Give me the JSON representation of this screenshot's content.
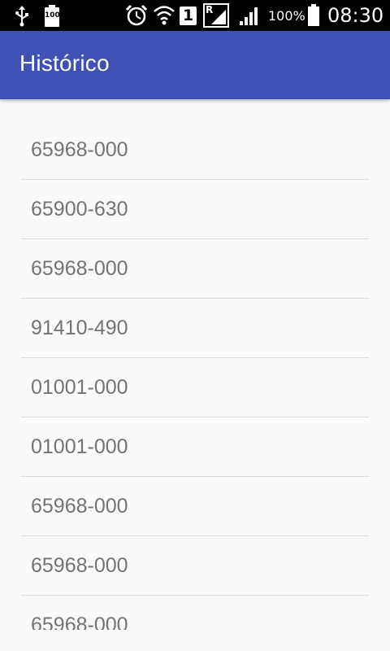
{
  "status_bar": {
    "battery_badge": "100",
    "sim_slot": "1",
    "roaming": "R",
    "battery_percent": "100%",
    "time": "08:30",
    "icons": [
      "usb-icon",
      "battery-saver-icon",
      "alarm-icon",
      "wifi-icon",
      "sim-icon",
      "roaming-signal-icon",
      "signal-icon",
      "battery-icon"
    ]
  },
  "app_bar": {
    "title": "Histórico",
    "color": "#3f51b5"
  },
  "history": {
    "items": [
      "65968-000",
      "65900-630",
      "65968-000",
      "91410-490",
      "01001-000",
      "01001-000",
      "65968-000",
      "65968-000",
      "65968-000"
    ]
  }
}
